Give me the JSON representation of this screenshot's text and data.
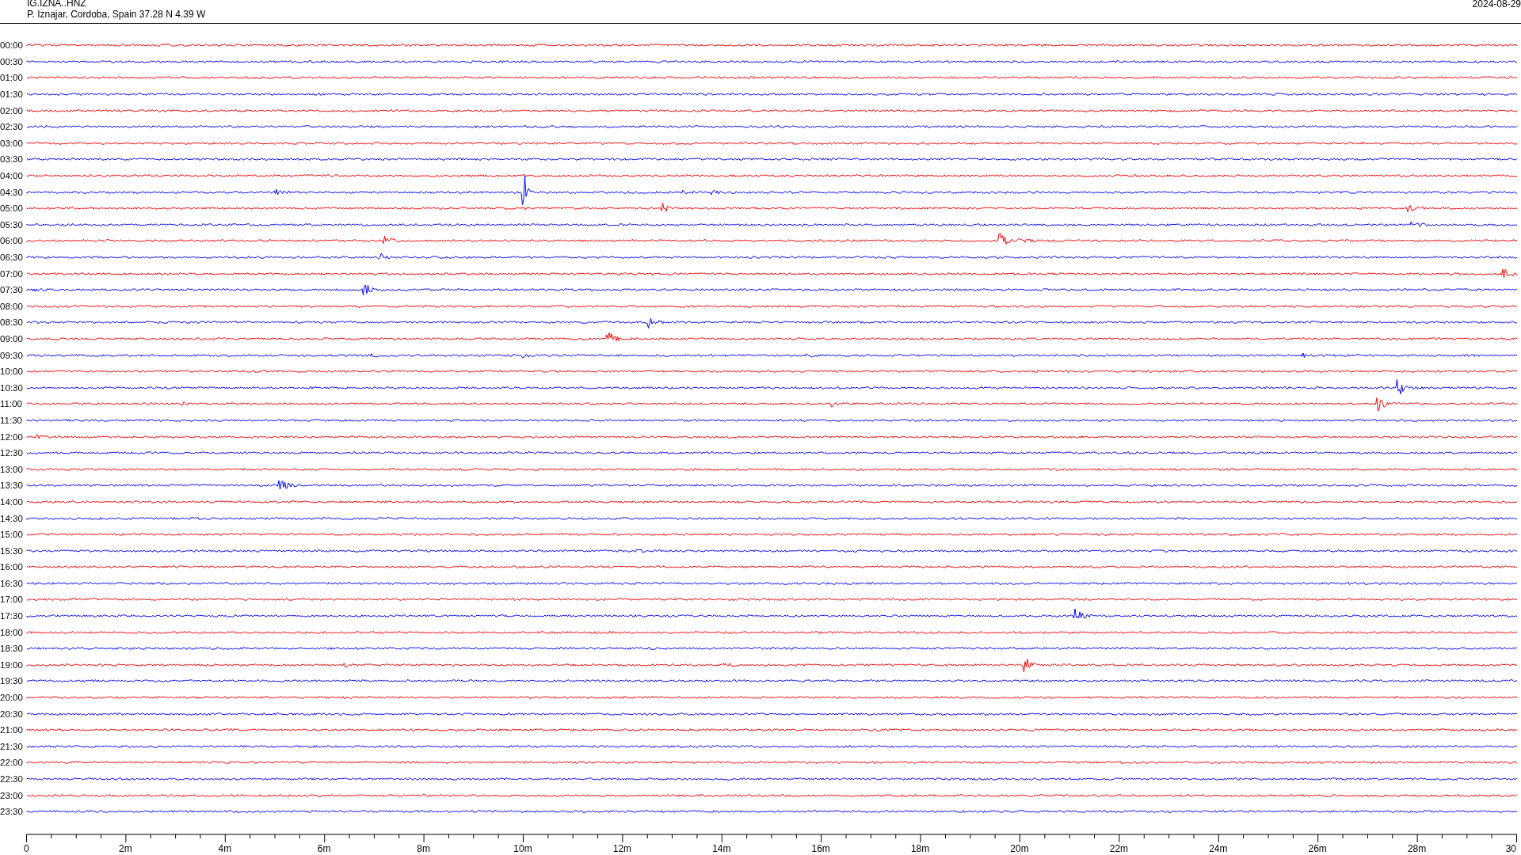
{
  "header": {
    "station": "IG.IZNA..HNZ",
    "location": "P. Iznajar, Cordoba, Spain  37.28 N 4.39 W",
    "date": "2024-08-29"
  },
  "rows": [
    {
      "label": "00:00",
      "color": "#ff0000"
    },
    {
      "label": "00:30",
      "color": "#0000ff"
    },
    {
      "label": "01:00",
      "color": "#ff0000"
    },
    {
      "label": "01:30",
      "color": "#0000ff"
    },
    {
      "label": "02:00",
      "color": "#ff0000"
    },
    {
      "label": "02:30",
      "color": "#0000ff"
    },
    {
      "label": "03:00",
      "color": "#ff0000"
    },
    {
      "label": "03:30",
      "color": "#0000ff"
    },
    {
      "label": "04:00",
      "color": "#ff0000"
    },
    {
      "label": "04:30",
      "color": "#0000ff"
    },
    {
      "label": "05:00",
      "color": "#ff0000"
    },
    {
      "label": "05:30",
      "color": "#0000ff"
    },
    {
      "label": "06:00",
      "color": "#ff0000"
    },
    {
      "label": "06:30",
      "color": "#0000ff"
    },
    {
      "label": "07:00",
      "color": "#ff0000"
    },
    {
      "label": "07:30",
      "color": "#0000ff"
    },
    {
      "label": "08:00",
      "color": "#ff0000"
    },
    {
      "label": "08:30",
      "color": "#0000ff"
    },
    {
      "label": "09:00",
      "color": "#ff0000"
    },
    {
      "label": "09:30",
      "color": "#0000ff"
    },
    {
      "label": "10:00",
      "color": "#ff0000"
    },
    {
      "label": "10:30",
      "color": "#0000ff"
    },
    {
      "label": "11:00",
      "color": "#ff0000"
    },
    {
      "label": "11:30",
      "color": "#0000ff"
    },
    {
      "label": "12:00",
      "color": "#ff0000"
    },
    {
      "label": "12:30",
      "color": "#0000ff"
    },
    {
      "label": "13:00",
      "color": "#ff0000"
    },
    {
      "label": "13:30",
      "color": "#0000ff"
    },
    {
      "label": "14:00",
      "color": "#ff0000"
    },
    {
      "label": "14:30",
      "color": "#0000ff"
    },
    {
      "label": "15:00",
      "color": "#ff0000"
    },
    {
      "label": "15:30",
      "color": "#0000ff"
    },
    {
      "label": "16:00",
      "color": "#ff0000"
    },
    {
      "label": "16:30",
      "color": "#0000ff"
    },
    {
      "label": "17:00",
      "color": "#ff0000"
    },
    {
      "label": "17:30",
      "color": "#0000ff"
    },
    {
      "label": "18:00",
      "color": "#ff0000"
    },
    {
      "label": "18:30",
      "color": "#0000ff"
    },
    {
      "label": "19:00",
      "color": "#ff0000"
    },
    {
      "label": "19:30",
      "color": "#0000ff"
    },
    {
      "label": "20:00",
      "color": "#ff0000"
    },
    {
      "label": "20:30",
      "color": "#0000ff"
    },
    {
      "label": "21:00",
      "color": "#ff0000"
    },
    {
      "label": "21:30",
      "color": "#0000ff"
    },
    {
      "label": "22:00",
      "color": "#ff0000"
    },
    {
      "label": "22:30",
      "color": "#0000ff"
    },
    {
      "label": "23:00",
      "color": "#ff0000"
    },
    {
      "label": "23:30",
      "color": "#0000ff"
    }
  ],
  "axis": {
    "labels": [
      "0",
      "2m",
      "4m",
      "6m",
      "8m",
      "10m",
      "12m",
      "14m",
      "16m",
      "18m",
      "20m",
      "22m",
      "24m",
      "26m",
      "28m",
      "30"
    ]
  }
}
